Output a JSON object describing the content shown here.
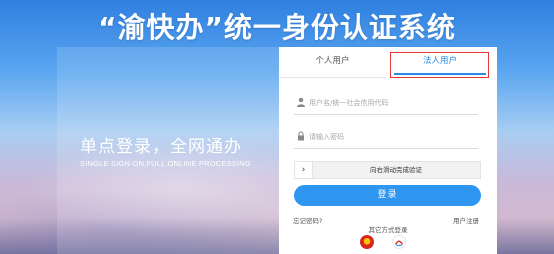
{
  "header": {
    "title": "“渝快办”统一身份认证系统"
  },
  "banner": {
    "slogan": "单点登录，全网通办",
    "slogan_en": "SINGLE SIGN ON,FULL ONLINE PROCESSING"
  },
  "login": {
    "tabs": [
      {
        "label": "个人用户",
        "active": false
      },
      {
        "label": "法人用户",
        "active": true
      }
    ],
    "username_placeholder": "用户名/统一社会信用代码",
    "password_placeholder": "请输入密码",
    "slider_text": "向右滑动完成验证",
    "submit_label": "登录",
    "forgot_label": "忘记密码?",
    "register_label": "用户注册",
    "other_methods_label": "其它方式登录",
    "other_methods": [
      "national-emblem-icon",
      "app-login-icon"
    ],
    "colors": {
      "accent": "#2e96f0",
      "highlight": "#e53935"
    }
  }
}
